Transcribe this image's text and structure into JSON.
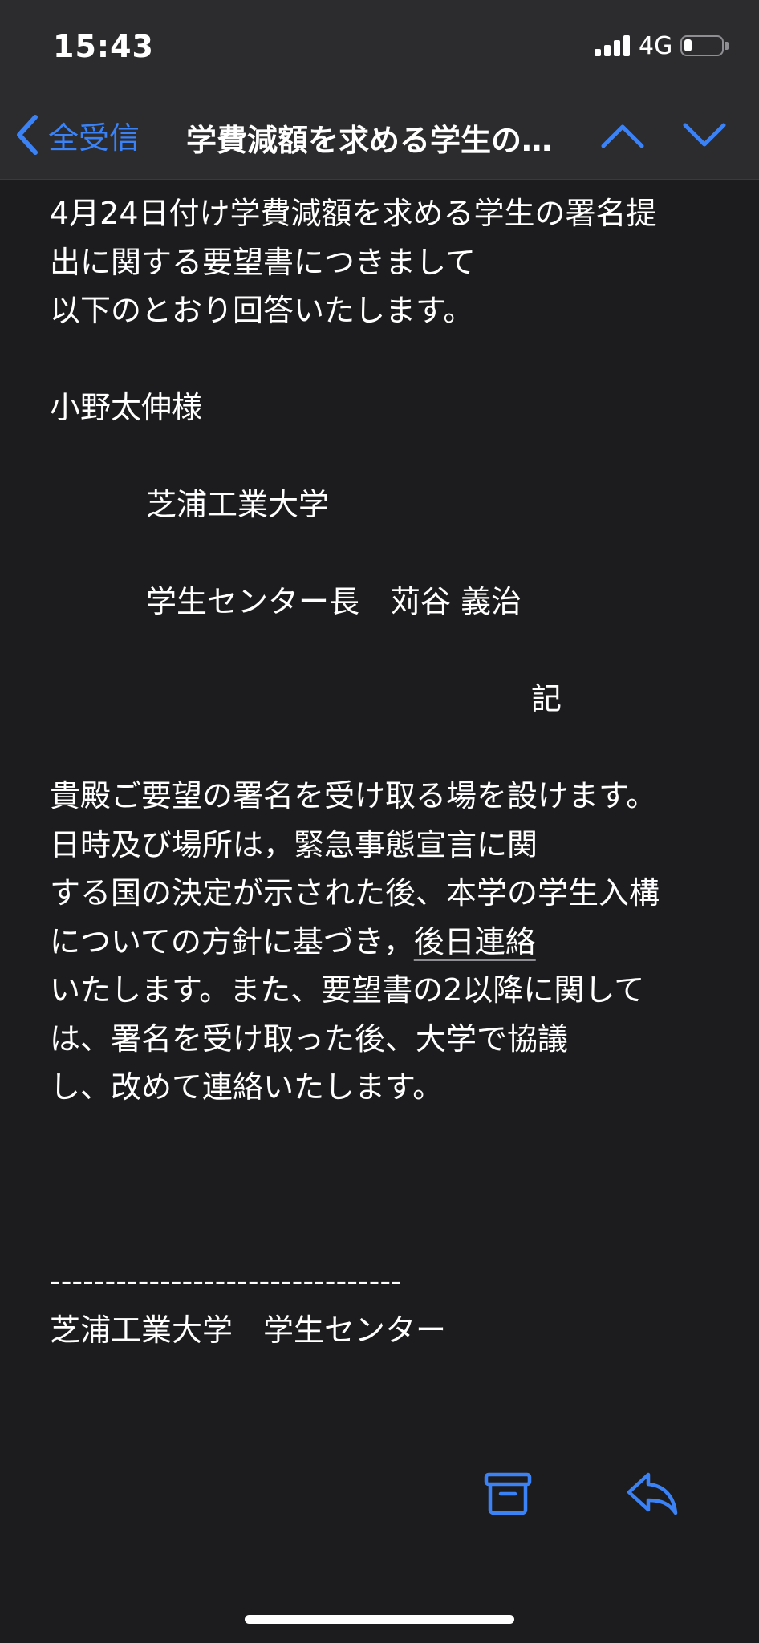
{
  "status": {
    "time": "15:43",
    "network": "4G",
    "battery_level": 0.2
  },
  "nav": {
    "back_label": "全受信",
    "title": "学費減額を求める学生の…",
    "accent": "#3b82f6"
  },
  "body": {
    "lines": [
      "4月24日付け学費減額を求める学生の署名提",
      "出に関する要望書につきまして",
      "以下のとおり回答いたします。",
      "",
      "小野太伸様",
      "",
      "芝浦工業大学",
      "",
      "学生センター長　苅谷 義治",
      "",
      "記",
      "",
      "貴殿ご要望の署名を受け取る場を設けます。",
      "日時及び場所は，緊急事態宣言に関",
      "する国の決定が示された後、本学の学生入構",
      "についての方針に基づき，",
      "いたします。また、要望書の2以降に関して",
      "は、署名を受け取った後、大学で協議",
      "し、改めて連絡いたします。",
      "",
      "",
      "",
      "--------------------------------",
      "芝浦工業大学　学生センター"
    ],
    "link_text": "後日連絡"
  },
  "icons": {
    "back": "chevron-left-icon",
    "prev": "chevron-up-icon",
    "next": "chevron-down-icon",
    "archive": "archive-icon",
    "reply": "reply-icon"
  }
}
